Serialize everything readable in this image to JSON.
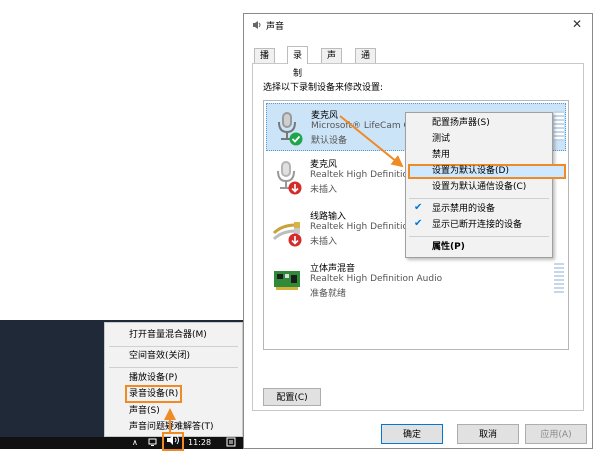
{
  "dialog": {
    "title": "声音",
    "close_glyph": "✕",
    "tabs": [
      "播放",
      "录制",
      "声音",
      "通信"
    ],
    "instruction": "选择以下录制设备来修改设置:",
    "devices": [
      {
        "name": "麦克风",
        "desc": "Microsoft® LifeCam C",
        "status": "默认设备",
        "badge": "check"
      },
      {
        "name": "麦克风",
        "desc": "Realtek High Definition",
        "status": "未插入",
        "badge": "down-arrow"
      },
      {
        "name": "线路输入",
        "desc": "Realtek High Definition",
        "status": "未插入",
        "badge": "down-arrow"
      },
      {
        "name": "立体声混音",
        "desc": "Realtek High Definition Audio",
        "status": "准备就绪",
        "badge": ""
      }
    ],
    "configure_button": "配置(C)",
    "ok_button": "确定",
    "cancel_button": "取消",
    "apply_button": "应用(A)"
  },
  "context_menu": {
    "items": [
      "配置扬声器(S)",
      "测试",
      "禁用",
      "设置为默认设备(D)",
      "设置为默认通信设备(C)"
    ],
    "checked_items": [
      "显示禁用的设备",
      "显示已断开连接的设备"
    ],
    "properties": "属性(P)",
    "check_glyph": "✔"
  },
  "tray_menu": {
    "items": [
      "打开音量混合器(M)",
      "空间音效(关闭)",
      "播放设备(P)",
      "录音设备(R)",
      "声音(S)",
      "声音问题疑难解答(T)"
    ]
  },
  "taskbar": {
    "chevron": "∧",
    "time": "11:28"
  },
  "colors": {
    "highlight_orange": "#f08a24",
    "selection_blue": "#cce4f7",
    "accent_blue": "#0078d7"
  }
}
